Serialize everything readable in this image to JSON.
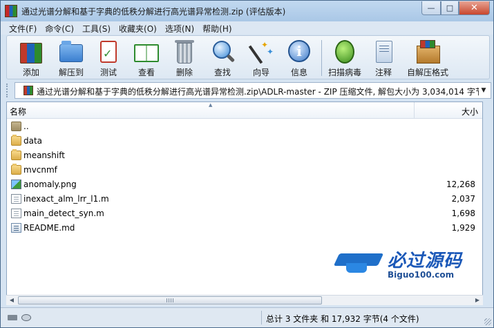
{
  "window": {
    "title": "通过光谱分解和基于字典的低秩分解进行高光谱异常检测.zip (评估版本)",
    "controls": {
      "minimize": "—",
      "maximize": "□",
      "close": "✕"
    }
  },
  "menu": [
    "文件(F)",
    "命令(C)",
    "工具(S)",
    "收藏夹(O)",
    "选项(N)",
    "帮助(H)"
  ],
  "toolbar": [
    {
      "label": "添加",
      "icon": "add-archive-icon"
    },
    {
      "label": "解压到",
      "icon": "extract-folder-icon"
    },
    {
      "label": "测试",
      "icon": "test-clipboard-icon"
    },
    {
      "label": "查看",
      "icon": "view-book-icon"
    },
    {
      "label": "删除",
      "icon": "delete-trash-icon"
    },
    {
      "label": "查找",
      "icon": "find-magnifier-icon"
    },
    {
      "label": "向导",
      "icon": "wizard-wand-icon"
    },
    {
      "label": "信息",
      "icon": "info-icon"
    },
    {
      "label": "扫描病毒",
      "icon": "virus-scan-icon"
    },
    {
      "label": "注释",
      "icon": "comment-icon"
    },
    {
      "label": "自解压格式",
      "icon": "sfx-box-icon"
    }
  ],
  "address": {
    "path": "通过光谱分解和基于字典的低秩分解进行高光谱异常检测.zip\\ADLR-master - ZIP 压缩文件, 解包大小为 3,034,014 字节"
  },
  "columns": {
    "name": "名称",
    "size": "大小"
  },
  "files": [
    {
      "name": "..",
      "size": "",
      "type": "parent"
    },
    {
      "name": "data",
      "size": "",
      "type": "folder"
    },
    {
      "name": "meanshift",
      "size": "",
      "type": "folder"
    },
    {
      "name": "mvcnmf",
      "size": "",
      "type": "folder"
    },
    {
      "name": "anomaly.png",
      "size": "12,268",
      "type": "image"
    },
    {
      "name": "inexact_alm_lrr_l1.m",
      "size": "2,037",
      "type": "file"
    },
    {
      "name": "main_detect_syn.m",
      "size": "1,698",
      "type": "file"
    },
    {
      "name": "README.md",
      "size": "1,929",
      "type": "markdown"
    }
  ],
  "watermark": {
    "title": "必过源码",
    "subtitle": "Biguo100.com"
  },
  "status": {
    "summary": "总计 3 文件夹 和 17,932 字节(4 个文件)"
  }
}
